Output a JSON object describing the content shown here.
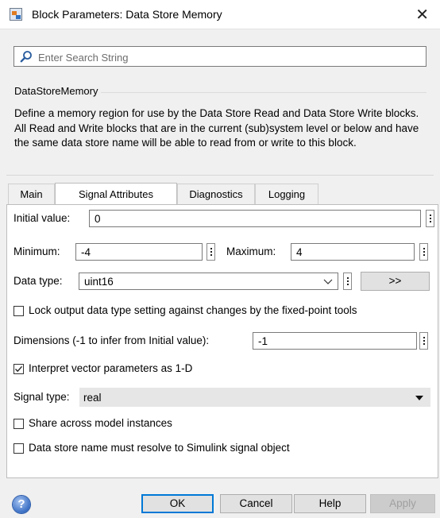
{
  "window": {
    "title": "Block Parameters: Data Store Memory",
    "close_glyph": "✕"
  },
  "search": {
    "placeholder": "Enter Search String",
    "value": ""
  },
  "block": {
    "name": "DataStoreMemory",
    "description": "Define a memory region for use by the Data Store Read and Data Store Write blocks. All Read and Write blocks that are in the current (sub)system level or below and have the same data store name will be able to read from or write to this block."
  },
  "tabs": [
    {
      "label": "Main",
      "active": false
    },
    {
      "label": "Signal Attributes",
      "active": true
    },
    {
      "label": "Diagnostics",
      "active": false
    },
    {
      "label": "Logging",
      "active": false
    }
  ],
  "signal_attributes": {
    "initial_value_label": "Initial value:",
    "initial_value": "0",
    "minimum_label": "Minimum:",
    "minimum": "-4",
    "maximum_label": "Maximum:",
    "maximum": "4",
    "data_type_label": "Data type:",
    "data_type": "uint16",
    "data_type_assistant_label": ">>",
    "lock_label": "Lock output data type setting against changes by the fixed-point tools",
    "lock_checked": false,
    "dimensions_label": "Dimensions (-1 to infer from Initial value):",
    "dimensions": "-1",
    "interpret_label": "Interpret vector parameters as 1-D",
    "interpret_checked": true,
    "signal_type_label": "Signal type:",
    "signal_type": "real",
    "share_label": "Share across model instances",
    "share_checked": false,
    "resolve_label": "Data store name must resolve to Simulink signal object",
    "resolve_checked": false
  },
  "footer": {
    "help_glyph": "?",
    "ok_label": "OK",
    "cancel_label": "Cancel",
    "help_label": "Help",
    "apply_label": "Apply"
  },
  "colors": {
    "accent": "#0078d7",
    "dialog_bg": "#f0f0f0",
    "panel_bg": "#ffffff"
  }
}
